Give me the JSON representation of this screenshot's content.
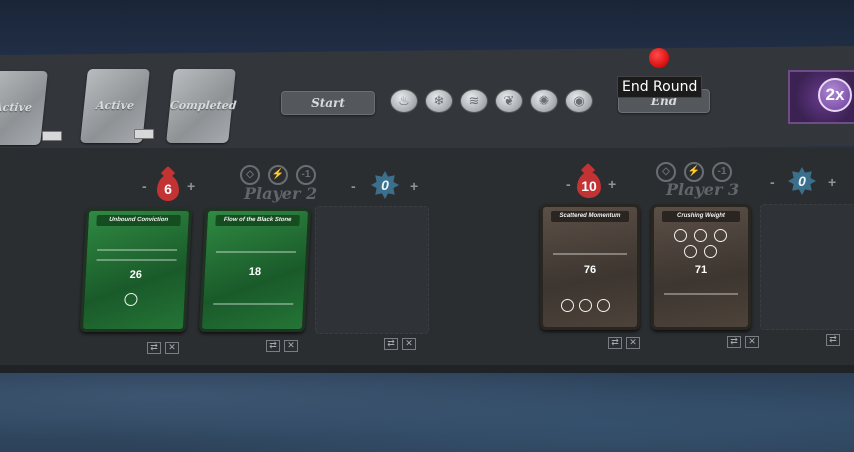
{
  "decks": [
    {
      "label": "Active"
    },
    {
      "label": "Active"
    },
    {
      "label": "Completed"
    }
  ],
  "buttons": {
    "start": "Start",
    "end": "End"
  },
  "elements": [
    {
      "name": "fire",
      "glyph": "♨"
    },
    {
      "name": "ice",
      "glyph": "❄"
    },
    {
      "name": "air",
      "glyph": "≋"
    },
    {
      "name": "earth",
      "glyph": "❦"
    },
    {
      "name": "light",
      "glyph": "✺"
    },
    {
      "name": "dark",
      "glyph": "◉"
    }
  ],
  "tooltip": "End Round",
  "round_badge": "2x",
  "players": [
    {
      "name": "Player 2",
      "hp": "6",
      "xp": "0",
      "minus": "-",
      "plus": "+",
      "status": [
        "◇",
        "⚡",
        "-1"
      ],
      "cards": [
        {
          "title": "Unbound Conviction",
          "initiative": "26"
        },
        {
          "title": "Flow of the Black Stone",
          "initiative": "18"
        }
      ]
    },
    {
      "name": "Player 3",
      "hp": "10",
      "xp": "0",
      "minus": "-",
      "plus": "+",
      "status": [
        "◇",
        "⚡",
        "-1"
      ],
      "cards": [
        {
          "title": "Scattered Momentum",
          "initiative": "76"
        },
        {
          "title": "Crushing Weight",
          "initiative": "71"
        }
      ]
    }
  ],
  "controls": {
    "swap": "⇄",
    "close": "✕"
  },
  "colors": {
    "blood": "#c43333",
    "xp_star": "#3c6f8c",
    "marker": "#d70d0d",
    "green_card": "#2f8a42",
    "brown_card": "#4d433b"
  }
}
